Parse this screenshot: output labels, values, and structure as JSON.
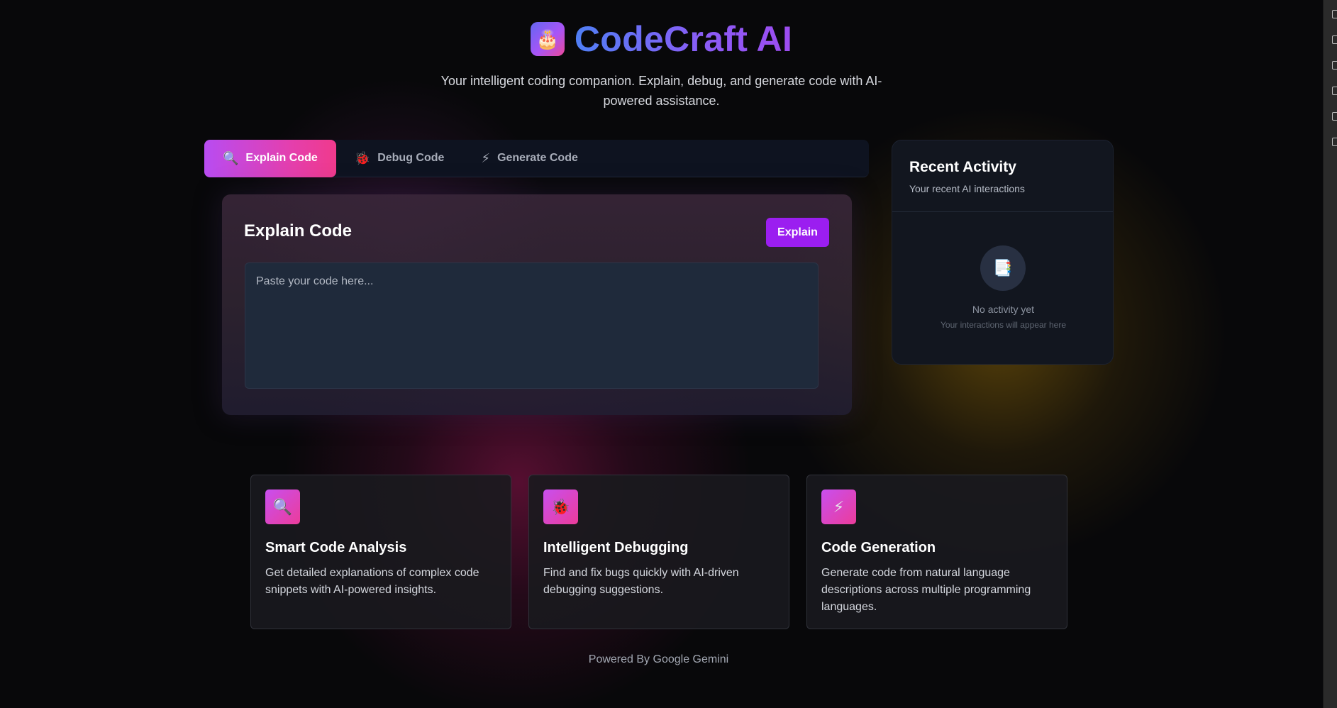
{
  "header": {
    "logo_icon": "cake-icon",
    "logo_glyph": "🎂",
    "title": "CodeCraft AI",
    "tagline": "Your intelligent coding companion. Explain, debug, and generate code with AI-powered assistance."
  },
  "tabs": [
    {
      "label": "Explain Code",
      "icon": "magnifier-icon",
      "glyph": "🔍",
      "active": true
    },
    {
      "label": "Debug Code",
      "icon": "bug-icon",
      "glyph": "🐞",
      "active": false
    },
    {
      "label": "Generate Code",
      "icon": "lightning-icon",
      "glyph": "⚡",
      "active": false
    }
  ],
  "panel": {
    "title": "Explain Code",
    "button_label": "Explain",
    "input_placeholder": "Paste your code here...",
    "input_value": ""
  },
  "recent": {
    "title": "Recent Activity",
    "subtitle": "Your recent AI interactions",
    "empty_icon": "files-icon",
    "empty_glyph": "📑",
    "empty_title": "No activity yet",
    "empty_subtitle": "Your interactions will appear here"
  },
  "features": [
    {
      "icon": "magnifier-icon",
      "glyph": "🔍",
      "title": "Smart Code Analysis",
      "description": "Get detailed explanations of complex code snippets with AI-powered insights."
    },
    {
      "icon": "bug-icon",
      "glyph": "🐞",
      "title": "Intelligent Debugging",
      "description": "Find and fix bugs quickly with AI-driven debugging suggestions."
    },
    {
      "icon": "lightning-icon",
      "glyph": "⚡",
      "title": "Code Generation",
      "description": "Generate code from natural language descriptions across multiple programming languages."
    }
  ],
  "footer": {
    "text": "Powered By Google Gemini"
  },
  "colors": {
    "accent_purple": "#9b1ef0",
    "tab_gradient_start": "#b84cf2",
    "tab_gradient_end": "#f03a8c",
    "title_gradient_start": "#4f7ff5",
    "title_gradient_end": "#9d4cf0"
  }
}
